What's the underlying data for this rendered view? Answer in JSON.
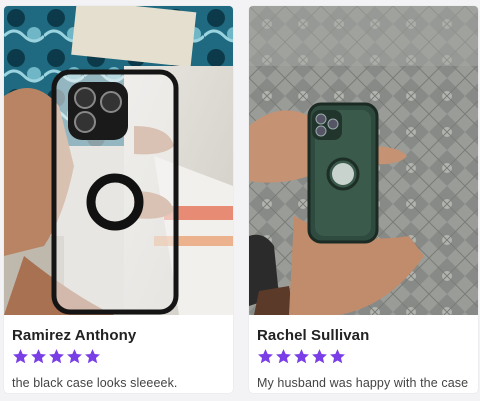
{
  "colors": {
    "star": "#7a3ee6",
    "card_bg": "#ffffff",
    "page_bg": "#f3f3f5"
  },
  "reviews": [
    {
      "name": "Ramirez Anthony",
      "rating": 5,
      "text": "the black case looks sleeeek.",
      "photo_icon": "phone-case-photo-black"
    },
    {
      "name": "Rachel Sullivan",
      "rating": 5,
      "text": "My husband was happy with the case I got him!",
      "photo_icon": "phone-case-photo-green"
    }
  ]
}
